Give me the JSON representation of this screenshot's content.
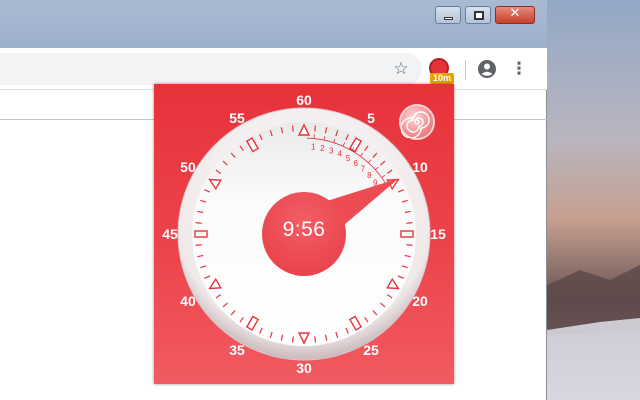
{
  "browser": {
    "window_controls": {
      "minimize_icon": "minimize-icon",
      "maximize_icon": "maximize-icon",
      "close_icon": "close-icon",
      "close_glyph": "✕"
    },
    "toolbar": {
      "bookmark_icon": "star-icon",
      "bookmark_glyph": "☆",
      "extension": {
        "icon": "timer-extension-icon",
        "badge": "10m",
        "badge_color": "#e7a300"
      },
      "profile_icon": "account-circle-icon",
      "menu_icon": "more-vert-icon",
      "menu_glyph": "⋮"
    }
  },
  "timer_popup": {
    "time_remaining": "9:56",
    "dial_labels": [
      "60",
      "5",
      "10",
      "15",
      "20",
      "25",
      "30",
      "35",
      "40",
      "45",
      "50",
      "55"
    ],
    "minute_scale_labels": [
      "1",
      "2",
      "3",
      "4",
      "5",
      "6",
      "7",
      "8",
      "9"
    ],
    "hand_position_minutes": 9.93,
    "settings_icon": "spiral-settings-icon",
    "colors": {
      "accent": "#e8323a",
      "face": "#ffffff",
      "marker": "#e8323a"
    }
  }
}
